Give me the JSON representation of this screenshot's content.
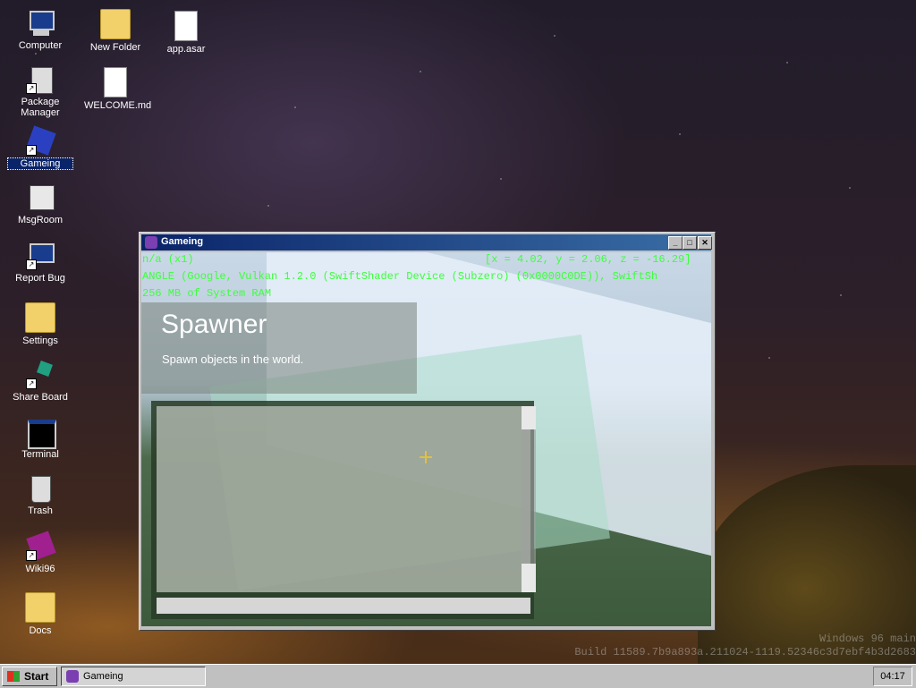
{
  "desktop": {
    "icons": [
      {
        "label": "Computer"
      },
      {
        "label": "New Folder"
      },
      {
        "label": "app.asar"
      },
      {
        "label": "Package Manager"
      },
      {
        "label": "WELCOME.md"
      },
      {
        "label": "Gameing"
      },
      {
        "label": "MsgRoom"
      },
      {
        "label": "Report Bug"
      },
      {
        "label": "Settings"
      },
      {
        "label": "Share Board"
      },
      {
        "label": "Terminal"
      },
      {
        "label": "Trash"
      },
      {
        "label": "Wiki96"
      },
      {
        "label": "Docs"
      }
    ],
    "watermark": {
      "line1": "Windows 96 main",
      "line2": "Build 11589.7b9a893a.211024-1119.52346c3d7ebf4b3d2683"
    }
  },
  "window": {
    "title": "Gameing",
    "hud": {
      "fps": "n/a (x1)",
      "coords": "[x = 4.02, y = 2.06, z = -16.29]",
      "renderer": "ANGLE (Google, Vulkan 1.2.0 (SwiftShader Device (Subzero) (0x0000C0DE)), SwiftSh",
      "ram": "256 MB of System RAM"
    },
    "panel": {
      "title": "Spawner",
      "subtitle": "Spawn objects in the world."
    }
  },
  "taskbar": {
    "start_label": "Start",
    "tasks": [
      {
        "label": "Gameing"
      }
    ],
    "clock": "04:17"
  },
  "colors": {
    "hud_text": "#3cff3c",
    "titlebar_start": "#0a246a",
    "titlebar_end": "#3a6ea5"
  }
}
